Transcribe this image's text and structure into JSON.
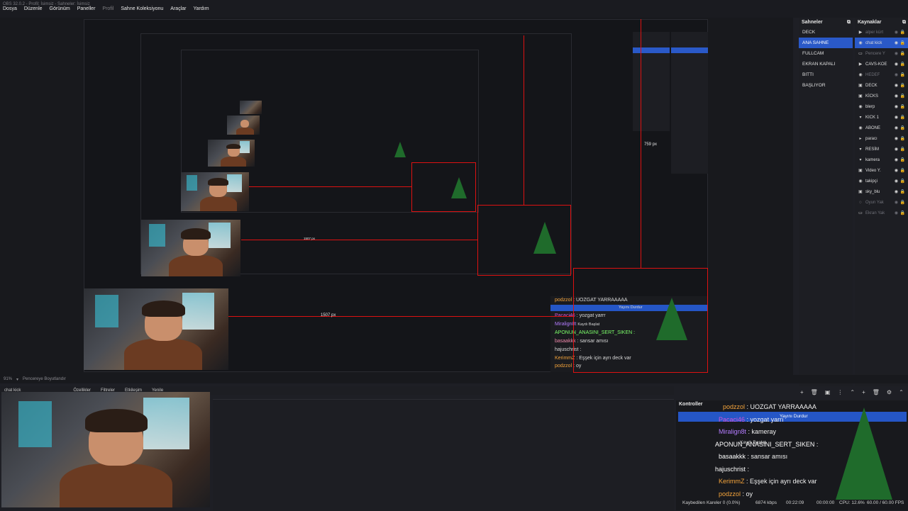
{
  "window": {
    "title": "OBS 32.0.2 - Profil: İsimsiz - Sahneler: İsimsiz"
  },
  "menu": [
    "Dosya",
    "Düzenle",
    "Görünüm",
    "Paneller",
    "Profil",
    "Sahne Koleksiyonu",
    "Araçlar",
    "Yardım"
  ],
  "preview": {
    "dim_labels": {
      "px1507": "1507 px",
      "px759": "759 px"
    },
    "chat": [
      {
        "user": "podzzol",
        "text": ": UOZGAT YARRAAAAA",
        "color": "#f3a33b"
      },
      {
        "user": "Yayını Durdur",
        "text": "",
        "color": "#ffffff",
        "button": true
      },
      {
        "user": "Pacaci46",
        "text": ": yozgat yarrr",
        "color": "#d255d8"
      },
      {
        "user": "Miralign8t",
        "text": "Kaydı Başlat",
        "color": "#b47cff"
      },
      {
        "user": "APONUN_ANASINI_SERT_SIKEN",
        "text": ":",
        "color": "#ffffff"
      },
      {
        "user": "basaakkk",
        "text": ": sansar amısı",
        "color": "#ffffff"
      },
      {
        "user": "hajuschrist",
        "text": ":",
        "color": "#ffffff"
      },
      {
        "user": "KerimmZ",
        "text": ": Eşşek için ayrı deck var",
        "color": "#f3a33b"
      },
      {
        "user": "podzzol",
        "text": ": oy",
        "color": "#f3a33b"
      }
    ]
  },
  "scenes": {
    "title": "Sahneler",
    "items": [
      "DECK",
      "ANA SAHNE",
      "FULLCAM",
      "EKRAN KAPALI",
      "BITTI",
      "BAŞLIYOR"
    ],
    "selected_index": 1
  },
  "sources": {
    "title": "Kaynaklar",
    "items": [
      {
        "icon": "▶",
        "label": "alper kürt",
        "dim": true
      },
      {
        "icon": "◉",
        "label": "chat kick",
        "selected": true
      },
      {
        "icon": "▭",
        "label": "Pencere Y",
        "dim": true
      },
      {
        "icon": "▶",
        "label": "CAVS-KOE"
      },
      {
        "icon": "◉",
        "label": "HEDEF",
        "dim": true
      },
      {
        "icon": "▣",
        "label": "DECK"
      },
      {
        "icon": "▣",
        "label": "KİCKS"
      },
      {
        "icon": "◉",
        "label": "blerp"
      },
      {
        "icon": "▾",
        "label": "KICK 1"
      },
      {
        "icon": "◉",
        "label": "ABONE"
      },
      {
        "icon": "▸",
        "label": "paracı"
      },
      {
        "icon": "▾",
        "label": "RESİM"
      },
      {
        "icon": "▾",
        "label": "kamera"
      },
      {
        "icon": "▣",
        "label": "Video Y."
      },
      {
        "icon": "◉",
        "label": "takipçi"
      },
      {
        "icon": "▣",
        "label": "sky_blu"
      },
      {
        "icon": "◌",
        "label": "Oyun Yak",
        "dim": true
      },
      {
        "icon": "▭",
        "label": "Ekran Yak",
        "dim": true
      }
    ]
  },
  "bottom_strip": {
    "zoom": "91%",
    "resize_label": "Pencereye Boyutlandır"
  },
  "source_toolbar": {
    "source": "chat kick",
    "properties": "Özellikler",
    "filters": "Filtreler",
    "interact": "Etkileşim",
    "refresh": "Yenile"
  },
  "controls": {
    "title": "Kontroller",
    "stream_btn": "Yayını Durdur",
    "record_btn": "Kaydı Başlat"
  },
  "big_chat": [
    {
      "user": "podzzol",
      "text": ": UOZGAT YARRAAAAA",
      "color": "#f3a33b"
    },
    {
      "user": "Pacaci46",
      "text": ": yozgat yarrı",
      "color": "#d255d8"
    },
    {
      "user": "Miralign8t",
      "text": ": kameray",
      "color": "#b47cff"
    },
    {
      "user": "APONUN_ANASINI_SERT_SIKEN",
      "text": ":",
      "color": "#ffffff"
    },
    {
      "user": "basaakkk",
      "text": ": sansar amısı",
      "color": "#ffffff"
    },
    {
      "user": "hajuschrist",
      "text": ":",
      "color": "#ffffff"
    },
    {
      "user": "KerimmZ",
      "text": ": Eşşek için ayrı deck var",
      "color": "#f3a33b"
    },
    {
      "user": "podzzol",
      "text": ": oy",
      "color": "#f3a33b"
    }
  ],
  "status": {
    "dropped": "Kaybedilen Kareler 0 (0.0%)",
    "bitrate": "6874 kbps",
    "stream_time": "00:22:09",
    "rec_time": "00:00:00",
    "cpu": "CPU: 12.6%",
    "fps": "60.00 / 60.00 FPS"
  }
}
